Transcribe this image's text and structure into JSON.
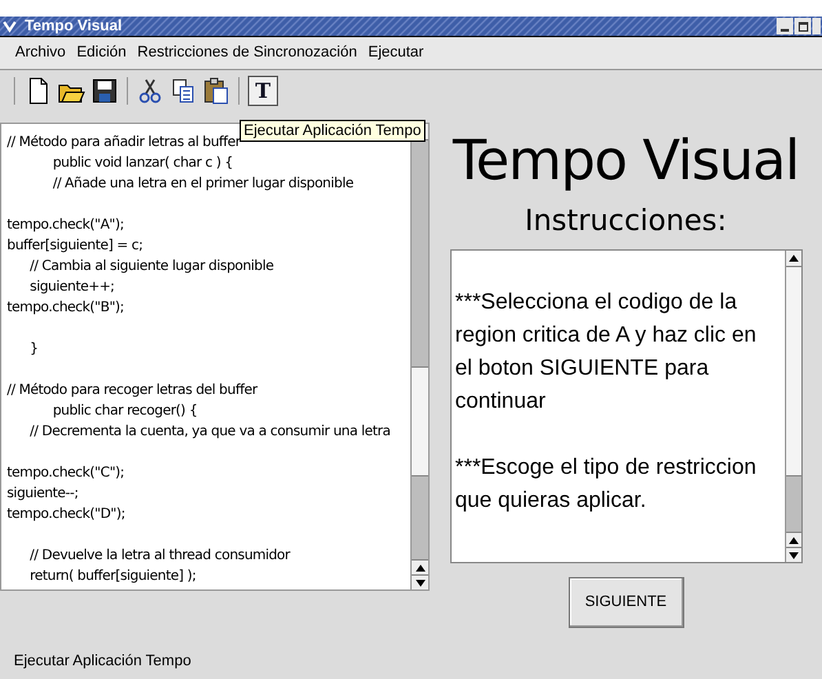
{
  "window": {
    "title": "Tempo Visual"
  },
  "menu": [
    {
      "label": "Archivo"
    },
    {
      "label": "Edición"
    },
    {
      "label": "Restricciones de Sincronozación"
    },
    {
      "label": "Ejecutar"
    }
  ],
  "toolbar": [
    {
      "kind": "new"
    },
    {
      "kind": "open"
    },
    {
      "kind": "save"
    },
    {
      "kind": "sep"
    },
    {
      "kind": "cut"
    },
    {
      "kind": "copy"
    },
    {
      "kind": "paste"
    },
    {
      "kind": "sep"
    },
    {
      "kind": "run",
      "pressed": true,
      "label": "T"
    }
  ],
  "tooltip": "Ejecutar Aplicación Tempo",
  "code_blocks": [
    [
      "// Método para añadir letras al buffer",
      "            public void lanzar( char c ) {",
      "            // Añade una letra en el primer lugar disponible"
    ],
    [
      "tempo.check(\"A\");",
      "buffer[siguiente] = c;",
      "      // Cambia al siguiente lugar disponible",
      "      siguiente++;",
      "tempo.check(\"B\");"
    ],
    [
      "      }"
    ],
    [
      "// Método para recoger letras del buffer",
      "            public char recoger() {",
      "      // Decrementa la cuenta, ya que va a consumir una letra"
    ],
    [
      "tempo.check(\"C\");",
      "siguiente--;",
      "tempo.check(\"D\");"
    ],
    [
      "      // Devuelve la letra al thread consumidor",
      "      return( buffer[siguiente] );"
    ]
  ],
  "panel": {
    "title": "Tempo Visual",
    "subtitle": "Instrucciones:",
    "paragraphs": [
      "***Selecciona el codigo de la region critica de A y haz clic en el boton SIGUIENTE para continuar",
      "***Escoge el tipo de restriccion que quieras aplicar."
    ],
    "button": "SIGUIENTE"
  },
  "status_bar": "Ejecutar Aplicación Tempo"
}
